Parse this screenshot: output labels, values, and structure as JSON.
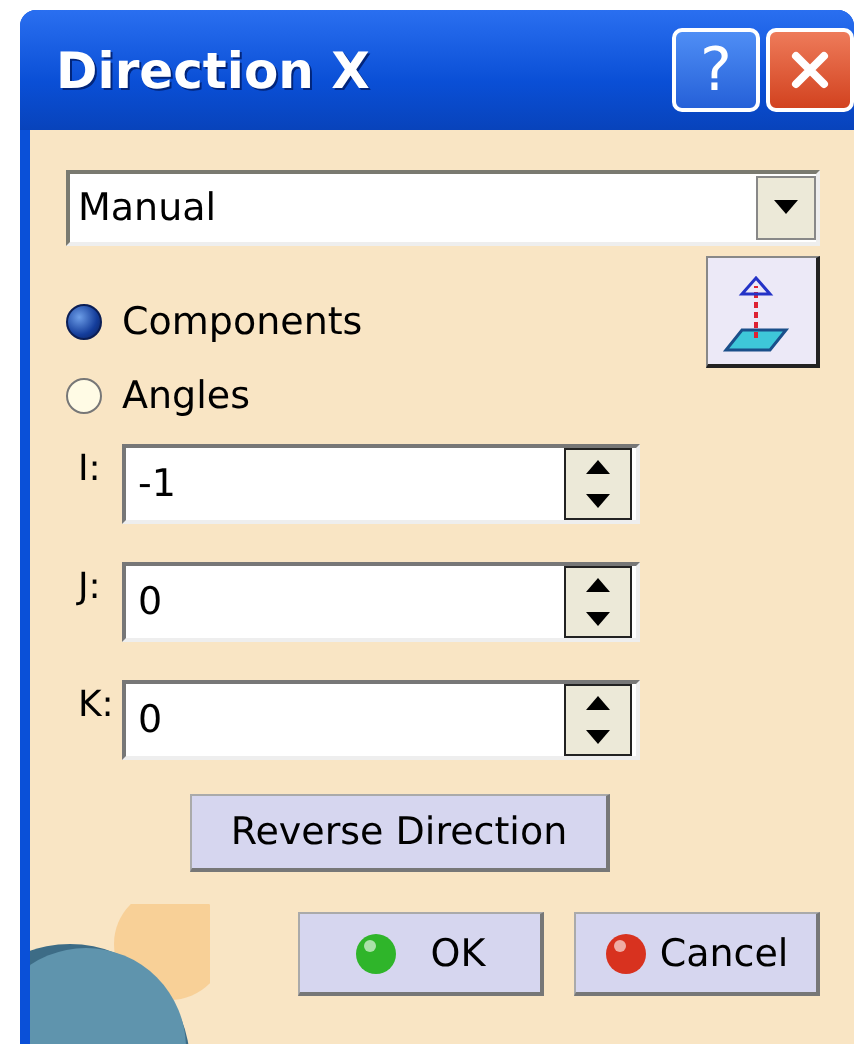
{
  "window": {
    "title": "Direction X",
    "help_button": "?"
  },
  "dropdown": {
    "value": "Manual"
  },
  "radios": [
    {
      "label": "Components",
      "selected": true
    },
    {
      "label": "Angles",
      "selected": false
    }
  ],
  "fields": [
    {
      "label": "I:",
      "value": "-1"
    },
    {
      "label": "J:",
      "value": "0"
    },
    {
      "label": "K:",
      "value": "0"
    }
  ],
  "reverse_button": "Reverse Direction",
  "buttons": [
    {
      "label": "OK",
      "kind": "ok"
    },
    {
      "label": "Cancel",
      "kind": "cancel"
    }
  ]
}
